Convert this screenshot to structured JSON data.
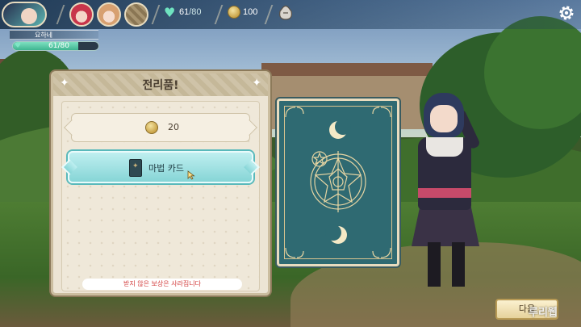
{
  "hud": {
    "stamina_current": "61",
    "stamina_max": "/80",
    "coins": "100",
    "icons": [
      "heart-icon",
      "coin-icon",
      "bag-icon",
      "gear-icon"
    ]
  },
  "player": {
    "name": "요하네",
    "hp_text": "61/80",
    "hp_fraction": 0.7625
  },
  "reward_panel": {
    "title": "전리품!",
    "rewards": [
      {
        "icon": "coin-icon",
        "label": "20"
      },
      {
        "icon": "magic-card-icon",
        "label": "마법 카드"
      }
    ],
    "notice": "받지 않은 보상은 사라집니다"
  },
  "next_button": {
    "label": "다음"
  },
  "watermark": "루리웹",
  "colors": {
    "accent_teal": "#86d5d6",
    "card_teal": "#2f6a72",
    "notice_red": "#d23a3a",
    "hp_green": "#3fb591"
  }
}
